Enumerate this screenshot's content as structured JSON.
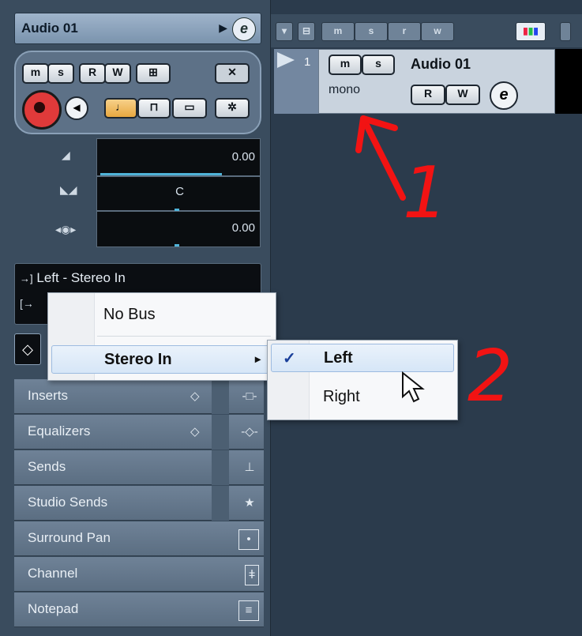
{
  "inspector": {
    "track_name": "Audio 01",
    "edit_glyph": "e",
    "buttons": {
      "mute": "m",
      "solo": "s",
      "read": "R",
      "write": "W"
    },
    "volume_value": "0.00",
    "pan_value": "C",
    "delay_value": "0.00",
    "routing": {
      "input": "Left - Stereo In",
      "input_icon": "→]",
      "output_icon": "[→"
    },
    "sections": [
      {
        "label": "Inserts"
      },
      {
        "label": "Equalizers"
      },
      {
        "label": "Sends"
      },
      {
        "label": "Studio Sends"
      },
      {
        "label": "Surround Pan"
      },
      {
        "label": "Channel"
      },
      {
        "label": "Notepad"
      }
    ]
  },
  "track_toolbar": {
    "buttons": [
      "m",
      "s",
      "r",
      "w"
    ]
  },
  "track": {
    "number": "1",
    "name": "Audio 01",
    "mode": "mono",
    "buttons": {
      "mute": "m",
      "solo": "s",
      "read": "R",
      "write": "W"
    },
    "edit_glyph": "e"
  },
  "menu": {
    "items": [
      {
        "label": "No Bus"
      },
      {
        "label": "Stereo In"
      }
    ],
    "submenu_arrow": "▸"
  },
  "submenu": {
    "items": [
      {
        "label": "Left",
        "checked": true,
        "check": "✓"
      },
      {
        "label": "Right"
      }
    ]
  },
  "annotations": {
    "one": "1",
    "two": "2"
  },
  "colors": {
    "annotation": "#f21313",
    "selection": "#d6e6f7",
    "panel": "#3a4c5e"
  }
}
